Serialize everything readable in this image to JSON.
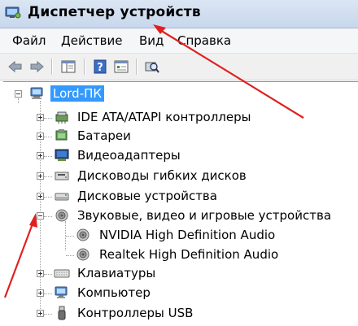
{
  "window": {
    "title": "Диспетчер устройств"
  },
  "menu": {
    "items": [
      "Файл",
      "Действие",
      "Вид",
      "Справка"
    ]
  },
  "toolbar": {
    "buttons": [
      "back-icon",
      "forward-icon",
      "show-hide-tree-icon",
      "help-icon",
      "properties-icon",
      "scan-hardware-icon"
    ]
  },
  "tree": {
    "root": "Lord-ПК",
    "categories": [
      {
        "label": "IDE ATA/ATAPI контроллеры",
        "icon": "ide-controller-icon",
        "expanded": false
      },
      {
        "label": "Батареи",
        "icon": "battery-icon",
        "expanded": false
      },
      {
        "label": "Видеоадаптеры",
        "icon": "display-adapter-icon",
        "expanded": false
      },
      {
        "label": "Дисководы гибких дисков",
        "icon": "floppy-drive-icon",
        "expanded": false
      },
      {
        "label": "Дисковые устройства",
        "icon": "disk-drive-icon",
        "expanded": false
      },
      {
        "label": "Звуковые, видео и игровые устройства",
        "icon": "speaker-icon",
        "expanded": true,
        "children": [
          "NVIDIA High Definition Audio",
          "Realtek High Definition Audio"
        ]
      },
      {
        "label": "Клавиатуры",
        "icon": "keyboard-icon",
        "expanded": false
      },
      {
        "label": "Компьютер",
        "icon": "computer-icon",
        "expanded": false
      },
      {
        "label": "Контроллеры USB",
        "icon": "usb-icon",
        "expanded": false
      }
    ]
  },
  "colors": {
    "selection": "#3399ff",
    "annotation_arrow": "#e02020"
  }
}
